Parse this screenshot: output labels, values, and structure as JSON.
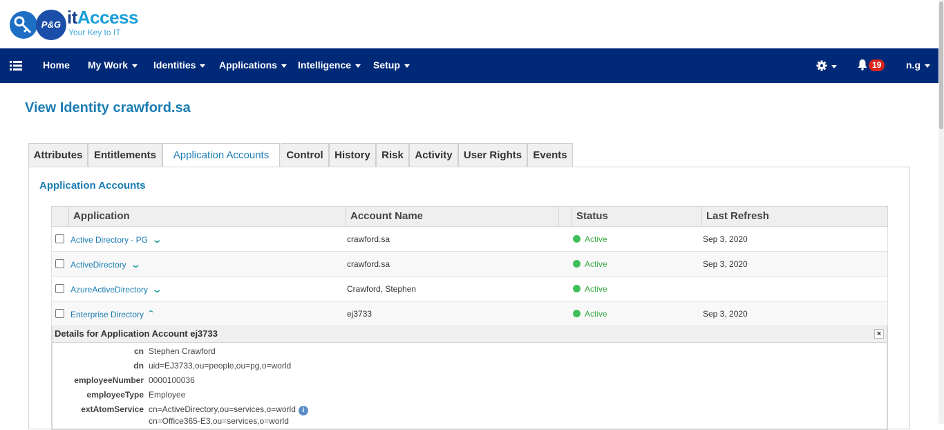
{
  "brand": {
    "logo_text": "P&G",
    "title_it": "it",
    "title_rest": "Access",
    "tagline": "Your Key to IT"
  },
  "nav": {
    "items": [
      {
        "label": "Home",
        "has_caret": false
      },
      {
        "label": "My Work",
        "has_caret": true
      },
      {
        "label": "Identities",
        "has_caret": true
      },
      {
        "label": "Applications",
        "has_caret": true
      },
      {
        "label": "Intelligence",
        "has_caret": true
      },
      {
        "label": "Setup",
        "has_caret": true
      }
    ],
    "notification_count": "19",
    "user": "n.g",
    "colors": {
      "bar": "#002a77",
      "badge": "#d9251c"
    }
  },
  "page": {
    "title": "View Identity crawford.sa"
  },
  "tabs": [
    {
      "label": "Attributes",
      "active": false
    },
    {
      "label": "Entitlements",
      "active": false
    },
    {
      "label": "Application Accounts",
      "active": true
    },
    {
      "label": "Control",
      "active": false
    },
    {
      "label": "History",
      "active": false
    },
    {
      "label": "Risk",
      "active": false
    },
    {
      "label": "Activity",
      "active": false
    },
    {
      "label": "User Rights",
      "active": false
    },
    {
      "label": "Events",
      "active": false
    }
  ],
  "section": {
    "title": "Application Accounts"
  },
  "grid": {
    "columns": [
      "Application",
      "Account Name",
      "Status",
      "Last Refresh"
    ],
    "rows": [
      {
        "application": "Active Directory - PG",
        "account": "crawford.sa",
        "status": "Active",
        "refresh": "Sep 3, 2020",
        "expanded": false
      },
      {
        "application": "ActiveDirectory",
        "account": "crawford.sa",
        "status": "Active",
        "refresh": "Sep 3, 2020",
        "expanded": false
      },
      {
        "application": "AzureActiveDirectory",
        "account": "Crawford, Stephen",
        "status": "Active",
        "refresh": "",
        "expanded": false
      },
      {
        "application": "Enterprise Directory",
        "account": "ej3733",
        "status": "Active",
        "refresh": "Sep 3, 2020",
        "expanded": true
      }
    ]
  },
  "details": {
    "title": "Details for Application Account ej3733",
    "close": "×",
    "fields": [
      {
        "label": "cn",
        "value": "Stephen Crawford"
      },
      {
        "label": "dn",
        "value": "uid=EJ3733,ou=people,ou=pg,o=world"
      },
      {
        "label": "employeeNumber",
        "value": "0000100036"
      },
      {
        "label": "employeeType",
        "value": "Employee"
      },
      {
        "label": "extAtomService",
        "value": "cn=ActiveDirectory,ou=services,o=world",
        "value2": "cn=Office365-E3,ou=services,o=world"
      }
    ]
  }
}
